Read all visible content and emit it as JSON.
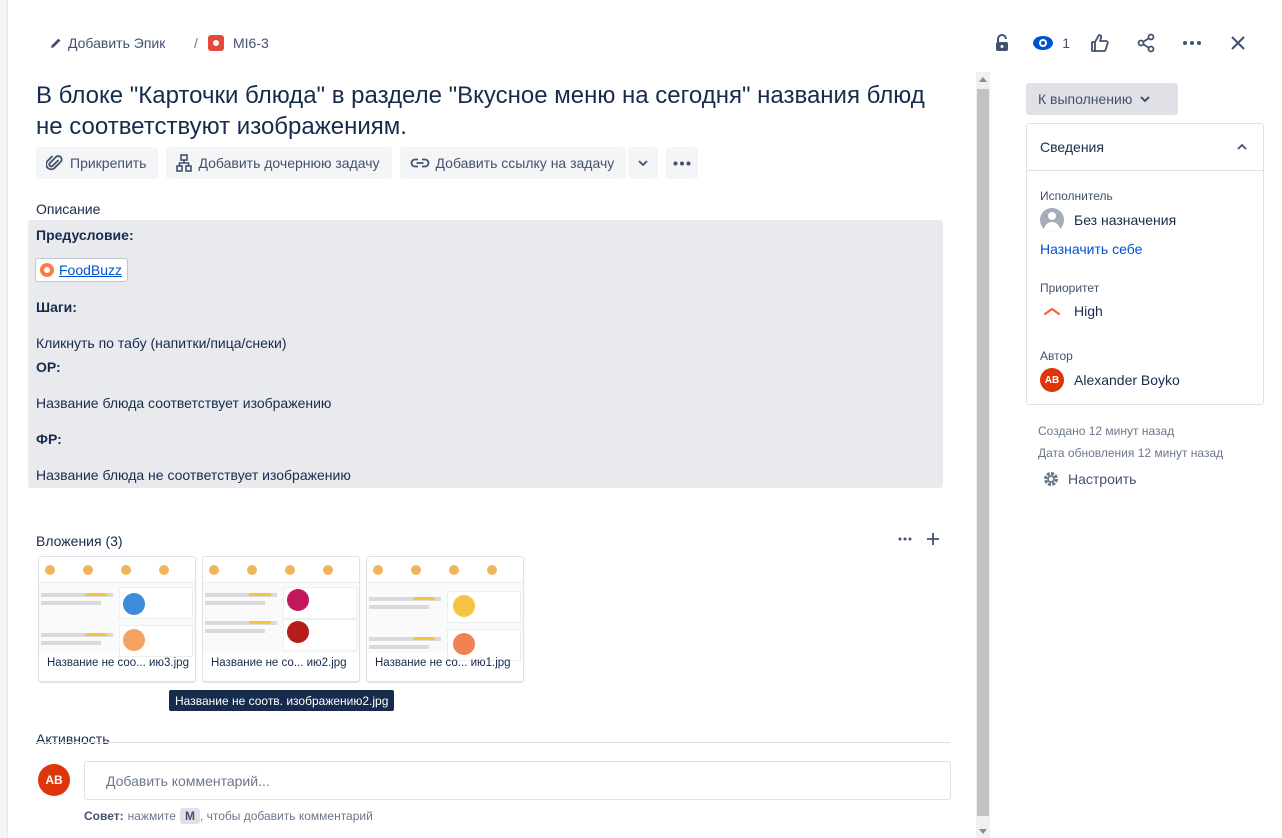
{
  "breadcrumb": {
    "epic_label": "Добавить Эпик",
    "separator": "/",
    "issue_key": "MI6-3"
  },
  "header_actions": {
    "watchers_count": "1"
  },
  "issue": {
    "title": "В блоке \"Карточки блюда\" в разделе \"Вкусное меню на сегодня\" названия блюд не соответствуют изображениям."
  },
  "toolbar": {
    "attach_label": "Прикрепить",
    "add_child_label": "Добавить дочернюю задачу",
    "link_issue_label": "Добавить ссылку на задачу"
  },
  "description": {
    "label": "Описание",
    "precondition_heading": "Предусловие:",
    "link_text": "FoodBuzz",
    "steps_heading": "Шаги:",
    "steps_text": "Кликнуть по табу (напитки/пица/снеки)",
    "expected_heading": "ОР:",
    "expected_text": "Название блюда соответствует изображению",
    "actual_heading": "ФР:",
    "actual_text": "Название блюда не соответствует изображению"
  },
  "attachments": {
    "label": "Вложения (3)",
    "items": [
      {
        "name": "Название не соо... ию3.jpg"
      },
      {
        "name": "Название не со... ию2.jpg"
      },
      {
        "name": "Название не со... ию1.jpg"
      }
    ],
    "tooltip": "Название не соотв. изображению2.jpg"
  },
  "activity": {
    "label": "Активность",
    "user_initials": "AB",
    "comment_placeholder": "Добавить комментарий...",
    "tip_prefix": "Совет:",
    "tip_middle": "нажмите",
    "tip_key": "M",
    "tip_suffix": ", чтобы добавить комментарий"
  },
  "sidebar": {
    "status_label": "К выполнению",
    "details_title": "Сведения",
    "assignee_label": "Исполнитель",
    "assignee_value": "Без назначения",
    "assign_self_link": "Назначить себе",
    "priority_label": "Приоритет",
    "priority_value": "High",
    "reporter_label": "Автор",
    "reporter_initials": "AB",
    "reporter_name": "Alexander Boyko",
    "created_text": "Создано 12 минут назад",
    "updated_text": "Дата обновления 12 минут назад",
    "configure_label": "Настроить"
  },
  "colors": {
    "accent": "#0052cc",
    "bug": "#e5493a",
    "avatar": "#de350b",
    "priority_high": "#ff5630"
  }
}
